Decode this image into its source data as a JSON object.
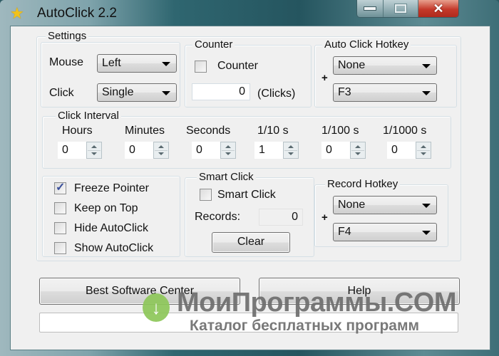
{
  "window": {
    "title": "AutoClick 2.2",
    "icon": "star-icon",
    "caption_buttons": [
      "minimize",
      "maximize",
      "close"
    ]
  },
  "settings": {
    "group_label": "Settings",
    "mouse_label": "Mouse",
    "mouse_value": "Left",
    "click_label": "Click",
    "click_value": "Single"
  },
  "counter": {
    "group_label": "Counter",
    "checkbox_label": "Counter",
    "checked": false,
    "value": "0",
    "unit": "(Clicks)"
  },
  "auto_click_hotkey": {
    "group_label": "Auto Click Hotkey",
    "plus": "+",
    "modifier": "None",
    "key": "F3"
  },
  "click_interval": {
    "group_label": "Click Interval",
    "fields": [
      {
        "label": "Hours",
        "value": "0"
      },
      {
        "label": "Minutes",
        "value": "0"
      },
      {
        "label": "Seconds",
        "value": "0"
      },
      {
        "label": "1/10 s",
        "value": "1"
      },
      {
        "label": "1/100 s",
        "value": "0"
      },
      {
        "label": "1/1000 s",
        "value": "0"
      }
    ]
  },
  "options": [
    {
      "label": "Freeze Pointer",
      "checked": true
    },
    {
      "label": "Keep on Top",
      "checked": false
    },
    {
      "label": "Hide AutoClick",
      "checked": false
    },
    {
      "label": "Show AutoClick",
      "checked": false
    }
  ],
  "smart_click": {
    "group_label": "Smart Click",
    "checkbox_label": "Smart Click",
    "checked": false,
    "records_label": "Records:",
    "records_value": "0",
    "clear_label": "Clear"
  },
  "record_hotkey": {
    "group_label": "Record Hotkey",
    "plus": "+",
    "modifier": "None",
    "key": "F4"
  },
  "buttons": {
    "best_software": "Best Software Center",
    "help": "Help"
  },
  "watermark": {
    "title": "МоиПрограммы.COM",
    "subtitle": "Каталог бесплатных программ",
    "icon": "↓"
  }
}
